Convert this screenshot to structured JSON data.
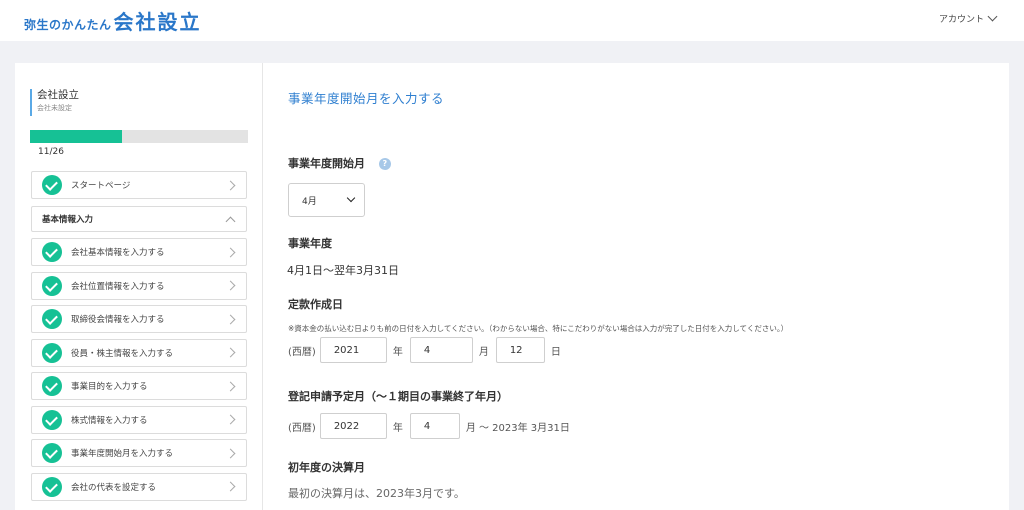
{
  "header": {
    "logo_small": "弥生のかんたん",
    "logo_big": "会社設立",
    "account": "アカウント"
  },
  "sidebar": {
    "title": "会社設立",
    "subtitle": "会社未設定",
    "progress_text": "11/26",
    "progress_fraction": 0.42,
    "start_page": "スタートページ",
    "section": "基本情報入力",
    "steps": [
      "会社基本情報を入力する",
      "会社位置情報を入力する",
      "取締役会情報を入力する",
      "役員・株主情報を入力する",
      "事業目的を入力する",
      "株式情報を入力する",
      "事業年度開始月を入力する",
      "会社の代表を設定する"
    ]
  },
  "main": {
    "page_title": "事業年度開始月を入力する",
    "start_month_label": "事業年度開始月",
    "help_icon": "?",
    "start_month_value": "4月",
    "fiscal_year_label": "事業年度",
    "fiscal_year_value": "4月1日～翌年3月31日",
    "articles_date_label": "定款作成日",
    "articles_note": "※資本金の払い込む日よりも前の日付を入力してください。（わからない場合、特にこだわりがない場合は入力が完了した日付を入力してください。）",
    "era": "(西暦)",
    "articles_year": "2021",
    "year_unit": "年",
    "articles_month": "4",
    "month_unit": "月",
    "articles_day": "12",
    "day_unit": "日",
    "registration_label": "登記申請予定月（～１期目の事業終了年月）",
    "registration_year": "2022",
    "registration_month": "4",
    "registration_suffix": "月 ～ 2023年 3月31日",
    "first_settlement_label": "初年度の決算月",
    "first_settlement_text": "最初の決算月は、2023年3月です。"
  }
}
